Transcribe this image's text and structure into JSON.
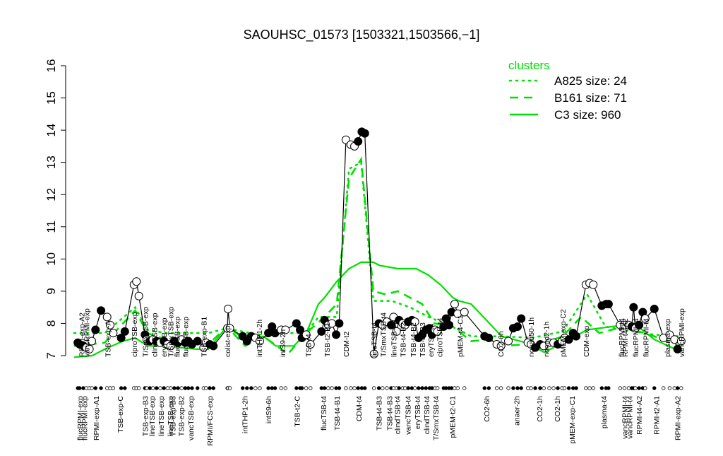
{
  "chart_data": {
    "type": "line",
    "title": "SAOUHSC_01573 [1503321,1503566,−1]",
    "xlabel": "",
    "ylabel": "",
    "xlim": [
      0,
      100
    ],
    "ylim": [
      7,
      16
    ],
    "yticks": [
      "7",
      "8",
      "9",
      "10",
      "11",
      "12",
      "13",
      "14",
      "15",
      "16"
    ],
    "grid": false,
    "legend": {
      "title": "clusters",
      "placement": "top-right",
      "entries": [
        {
          "label": "A825 size: 24",
          "style": "dotted"
        },
        {
          "label": "B161 size: 71",
          "style": "dashed"
        },
        {
          "label": "C3 size: 960",
          "style": "solid"
        }
      ]
    },
    "colors": {
      "cluster": "#00e000",
      "points": "#000000"
    },
    "points": [
      [
        0.6,
        7.4,
        1
      ],
      [
        0.9,
        7.35,
        1
      ],
      [
        1.5,
        7.3,
        1
      ],
      [
        2.0,
        7.25,
        0
      ],
      [
        2.5,
        7.2,
        0
      ],
      [
        2.9,
        7.45,
        0
      ],
      [
        3.5,
        7.8,
        1
      ],
      [
        4.4,
        8.4,
        1
      ],
      [
        5.4,
        8.2,
        0
      ],
      [
        5.9,
        7.95,
        0
      ],
      [
        6.4,
        7.7,
        0
      ],
      [
        7.7,
        7.55,
        1
      ],
      [
        8.3,
        7.75,
        1
      ],
      [
        9.8,
        9.2,
        0
      ],
      [
        10.2,
        9.3,
        0
      ],
      [
        10.6,
        8.85,
        0
      ],
      [
        11.6,
        7.65,
        1
      ],
      [
        11.9,
        7.5,
        0
      ],
      [
        12.4,
        7.45,
        1
      ],
      [
        12.9,
        7.5,
        0
      ],
      [
        13.5,
        7.45,
        1
      ],
      [
        14.1,
        7.4,
        0
      ],
      [
        14.7,
        7.45,
        1
      ],
      [
        15.3,
        7.35,
        0
      ],
      [
        15.8,
        7.3,
        0
      ],
      [
        16.4,
        7.45,
        1
      ],
      [
        17.0,
        7.4,
        1
      ],
      [
        17.6,
        7.5,
        0
      ],
      [
        18.2,
        7.4,
        1
      ],
      [
        18.7,
        7.45,
        1
      ],
      [
        19.3,
        7.35,
        1
      ],
      [
        20.2,
        7.45,
        1
      ],
      [
        21.2,
        7.25,
        0
      ],
      [
        21.6,
        7.4,
        0
      ],
      [
        22.2,
        7.35,
        1
      ],
      [
        22.8,
        7.3,
        1
      ],
      [
        25.1,
        7.85,
        0
      ],
      [
        25.2,
        8.45,
        0
      ],
      [
        25.5,
        7.85,
        0
      ],
      [
        27.6,
        7.6,
        1
      ],
      [
        28.3,
        7.45,
        1
      ],
      [
        29.0,
        7.6,
        1
      ],
      [
        29.7,
        7.55,
        0
      ],
      [
        30.4,
        7.45,
        0
      ],
      [
        31.8,
        7.7,
        1
      ],
      [
        32.4,
        7.9,
        1
      ],
      [
        32.9,
        7.7,
        1
      ],
      [
        33.9,
        7.8,
        0
      ],
      [
        34.6,
        7.8,
        0
      ],
      [
        36.4,
        8.0,
        1
      ],
      [
        37.0,
        7.8,
        1
      ],
      [
        37.3,
        7.55,
        1
      ],
      [
        38.0,
        7.65,
        0
      ],
      [
        38.7,
        7.35,
        0
      ],
      [
        40.5,
        7.75,
        1
      ],
      [
        41.0,
        8.1,
        1
      ],
      [
        41.6,
        7.95,
        0
      ],
      [
        42.2,
        8.0,
        0
      ],
      [
        42.9,
        7.65,
        1
      ],
      [
        43.4,
        8.0,
        1
      ],
      [
        44.5,
        13.7,
        0
      ],
      [
        45.3,
        13.55,
        0
      ],
      [
        45.9,
        13.5,
        0
      ],
      [
        46.5,
        13.65,
        1
      ],
      [
        47.1,
        13.95,
        1
      ],
      [
        47.6,
        13.9,
        1
      ],
      [
        49.1,
        7.05,
        0
      ],
      [
        49.9,
        8.0,
        1
      ],
      [
        50.5,
        7.95,
        0
      ],
      [
        51.2,
        8.05,
        0
      ],
      [
        51.9,
        7.95,
        1
      ],
      [
        52.3,
        8.2,
        0
      ],
      [
        52.8,
        7.75,
        0
      ],
      [
        53.2,
        8.1,
        1
      ],
      [
        53.8,
        8.0,
        0
      ],
      [
        54.2,
        7.95,
        0
      ],
      [
        54.7,
        8.05,
        1
      ],
      [
        55.3,
        8.1,
        1
      ],
      [
        55.8,
        8.05,
        0
      ],
      [
        56.4,
        7.55,
        1
      ],
      [
        57.0,
        7.65,
        1
      ],
      [
        57.6,
        7.8,
        1
      ],
      [
        58.2,
        7.85,
        1
      ],
      [
        58.6,
        7.65,
        1
      ],
      [
        59.1,
        7.8,
        0
      ],
      [
        59.5,
        7.75,
        0
      ],
      [
        60.5,
        7.9,
        1
      ],
      [
        60.9,
        8.15,
        1
      ],
      [
        61.4,
        7.95,
        1
      ],
      [
        61.8,
        8.35,
        1
      ],
      [
        62.3,
        8.6,
        0
      ],
      [
        62.8,
        8.3,
        0
      ],
      [
        63.9,
        8.35,
        0
      ],
      [
        67.2,
        7.6,
        1
      ],
      [
        67.9,
        7.55,
        1
      ],
      [
        69.2,
        7.35,
        0
      ],
      [
        69.9,
        7.3,
        0
      ],
      [
        71.1,
        7.45,
        0
      ],
      [
        71.9,
        7.85,
        1
      ],
      [
        72.6,
        7.9,
        1
      ],
      [
        73.2,
        8.15,
        1
      ],
      [
        74.3,
        7.4,
        0
      ],
      [
        74.8,
        7.35,
        0
      ],
      [
        75.5,
        7.25,
        1
      ],
      [
        76.3,
        7.35,
        1
      ],
      [
        76.9,
        7.3,
        0
      ],
      [
        77.8,
        7.4,
        0
      ],
      [
        78.5,
        7.4,
        0
      ],
      [
        79.2,
        7.35,
        1
      ],
      [
        79.9,
        7.45,
        0
      ],
      [
        80.3,
        7.55,
        0
      ],
      [
        81.0,
        7.5,
        1
      ],
      [
        81.7,
        7.7,
        1
      ],
      [
        82.2,
        7.6,
        1
      ],
      [
        83.8,
        9.2,
        0
      ],
      [
        84.4,
        9.25,
        0
      ],
      [
        85.0,
        9.2,
        0
      ],
      [
        86.4,
        8.55,
        1
      ],
      [
        87.1,
        8.6,
        1
      ],
      [
        87.5,
        8.6,
        1
      ],
      [
        89.4,
        7.95,
        0
      ],
      [
        90.1,
        7.95,
        0
      ],
      [
        90.8,
        7.95,
        0
      ],
      [
        91.3,
        7.9,
        1
      ],
      [
        91.6,
        8.5,
        1
      ],
      [
        91.9,
        7.85,
        0
      ],
      [
        92.5,
        7.95,
        1
      ],
      [
        93.1,
        8.35,
        1
      ],
      [
        93.5,
        8.15,
        0
      ],
      [
        95.0,
        8.45,
        1
      ],
      [
        96.5,
        7.55,
        0
      ],
      [
        97.5,
        7.65,
        0
      ],
      [
        98.3,
        7.5,
        0
      ],
      [
        98.8,
        7.2,
        1
      ],
      [
        99.4,
        7.45,
        0
      ]
    ],
    "series": [
      {
        "name": "C3",
        "style": "solid",
        "values": [
          [
            0,
            6.95
          ],
          [
            3,
            7.0
          ],
          [
            5,
            7.2
          ],
          [
            8,
            7.45
          ],
          [
            10,
            7.55
          ],
          [
            12,
            7.3
          ],
          [
            15,
            7.3
          ],
          [
            20,
            7.2
          ],
          [
            22,
            7.2
          ],
          [
            25,
            7.9
          ],
          [
            28,
            7.5
          ],
          [
            31,
            7.6
          ],
          [
            33,
            7.3
          ],
          [
            36,
            7.3
          ],
          [
            38,
            7.7
          ],
          [
            40,
            8.6
          ],
          [
            41,
            8.8
          ],
          [
            43,
            9.3
          ],
          [
            45,
            9.7
          ],
          [
            47,
            9.9
          ],
          [
            49,
            9.9
          ],
          [
            50,
            9.8
          ],
          [
            53,
            9.7
          ],
          [
            56,
            9.7
          ],
          [
            58,
            9.5
          ],
          [
            60,
            9.2
          ],
          [
            62,
            8.8
          ],
          [
            63,
            8.7
          ],
          [
            65,
            8.6
          ],
          [
            68,
            8.0
          ],
          [
            70,
            7.6
          ],
          [
            74,
            7.4
          ],
          [
            77,
            7.1
          ],
          [
            80,
            7.4
          ],
          [
            84,
            7.8
          ],
          [
            90,
            7.95
          ],
          [
            92,
            7.95
          ],
          [
            95,
            7.5
          ],
          [
            99,
            7.15
          ]
        ]
      },
      {
        "name": "B161",
        "style": "dashed",
        "values": [
          [
            0,
            7.3
          ],
          [
            5,
            7.4
          ],
          [
            10,
            8.4
          ],
          [
            12,
            7.7
          ],
          [
            15,
            7.5
          ],
          [
            22,
            7.35
          ],
          [
            25,
            7.9
          ],
          [
            28,
            7.3
          ],
          [
            31,
            7.6
          ],
          [
            35,
            7.05
          ],
          [
            38,
            7.7
          ],
          [
            41,
            8.2
          ],
          [
            43,
            8.6
          ],
          [
            45,
            12.5
          ],
          [
            47,
            13.1
          ],
          [
            49,
            9.0
          ],
          [
            51,
            8.9
          ],
          [
            53,
            9.0
          ],
          [
            55,
            8.8
          ],
          [
            57,
            8.6
          ],
          [
            59,
            8.0
          ],
          [
            62,
            7.9
          ],
          [
            65,
            7.45
          ],
          [
            68,
            7.5
          ],
          [
            70,
            7.3
          ],
          [
            74,
            7.35
          ],
          [
            77,
            7.4
          ],
          [
            80,
            7.6
          ],
          [
            83,
            8.2
          ],
          [
            86,
            7.7
          ],
          [
            90,
            7.9
          ],
          [
            95,
            7.6
          ],
          [
            99,
            7.3
          ]
        ]
      },
      {
        "name": "A825",
        "style": "dotted",
        "values": [
          [
            0,
            7.7
          ],
          [
            5,
            7.7
          ],
          [
            10,
            8.5
          ],
          [
            12,
            7.8
          ],
          [
            15,
            7.7
          ],
          [
            22,
            7.7
          ],
          [
            25,
            7.85
          ],
          [
            30,
            7.65
          ],
          [
            35,
            7.7
          ],
          [
            38,
            7.7
          ],
          [
            40,
            8.2
          ],
          [
            43,
            8.2
          ],
          [
            45,
            12.8
          ],
          [
            47,
            13.0
          ],
          [
            49,
            8.7
          ],
          [
            52,
            8.7
          ],
          [
            55,
            8.5
          ],
          [
            58,
            8.2
          ],
          [
            62,
            7.9
          ],
          [
            65,
            7.6
          ],
          [
            70,
            7.6
          ],
          [
            75,
            7.55
          ],
          [
            80,
            7.75
          ],
          [
            84,
            8.9
          ],
          [
            87,
            7.9
          ],
          [
            90,
            7.8
          ],
          [
            95,
            7.65
          ],
          [
            99,
            7.6
          ]
        ]
      }
    ],
    "point_labels": [
      [
        1.2,
        "RPMI-exp-A2"
      ],
      [
        2.0,
        "vancRPMI-exp"
      ],
      [
        5.5,
        "TSB-exp-A"
      ],
      [
        9.8,
        "ciproTSB-exp"
      ],
      [
        11.6,
        "T/SmxTSB-exp"
      ],
      [
        13.1,
        "clindTSB-exp"
      ],
      [
        14.7,
        "eryTSB-exp"
      ],
      [
        15.8,
        "T/SmxTSB-exp"
      ],
      [
        16.8,
        "flucTSB-exp"
      ],
      [
        18.2,
        "flucTSB-exp"
      ],
      [
        21.2,
        "TSB-exp-B1"
      ],
      [
        25.1,
        "colist-exp"
      ],
      [
        30.3,
        "intTHP1-2h"
      ],
      [
        34.1,
        "intS9-2h"
      ],
      [
        38.3,
        "TSB-t4"
      ],
      [
        41.4,
        "TSB-t2-B1"
      ],
      [
        44.5,
        "CDM-t2"
      ],
      [
        49.1,
        "lineTSB-t4"
      ],
      [
        50.6,
        "T/SmxTSB-t4"
      ],
      [
        52.3,
        "lineTSB-t4"
      ],
      [
        53.8,
        "TSB-t4-B2"
      ],
      [
        55.5,
        "TSB-t4-B2"
      ],
      [
        57.0,
        "TSB-t4-B3"
      ],
      [
        58.4,
        "eryTSB-t4"
      ],
      [
        59.8,
        "ciproTSB-t4"
      ],
      [
        63.2,
        "pMEM-t4-C1"
      ],
      [
        69.8,
        "CO2-6h"
      ],
      [
        74.8,
        "nonad50-1h"
      ],
      [
        77.3,
        "nonad2-1h"
      ],
      [
        80.0,
        "pMEM-exp-C2"
      ],
      [
        83.8,
        "CDM-exp"
      ],
      [
        89.6,
        "flucRPMI-t4"
      ],
      [
        90.2,
        "RPMI-t4-A2"
      ],
      [
        91.9,
        "flucRPMI-t4"
      ],
      [
        93.6,
        "flucRPMI-t4"
      ],
      [
        97.1,
        "plasma-exp"
      ],
      [
        99.4,
        "vancRPMI-exp"
      ]
    ],
    "axis_labels": [
      [
        0.9,
        "flucRPMI-exp"
      ],
      [
        1.7,
        "flucRPMI-exp"
      ],
      [
        3.6,
        "RPMI-exp-A1"
      ],
      [
        7.5,
        "TSB-exp-C"
      ],
      [
        11.6,
        "TSB-exp-B3"
      ],
      [
        12.7,
        "lineTSB-exp"
      ],
      [
        14.2,
        "lineTSB-exp"
      ],
      [
        15.7,
        "lineTSB-exp"
      ],
      [
        16.1,
        "TSB-exp-B3"
      ],
      [
        17.5,
        "TSB-exp-B2"
      ],
      [
        19.1,
        "vancTSB-exp"
      ],
      [
        22.2,
        "RPMI/FCS-exp"
      ],
      [
        27.9,
        "intTHP1-2h"
      ],
      [
        31.8,
        "intS9-6h"
      ],
      [
        36.5,
        "TSB-t2-C"
      ],
      [
        40.8,
        "flucTSB-t4"
      ],
      [
        43.0,
        "TSB-t4-B1"
      ],
      [
        46.6,
        "CDM-t4"
      ],
      [
        49.9,
        "TSB-t4-B3"
      ],
      [
        51.6,
        "TSB-t4-B3"
      ],
      [
        52.9,
        "clindTSB-t4"
      ],
      [
        54.6,
        "vancTSB-t4"
      ],
      [
        56.2,
        "eryTSB-t4"
      ],
      [
        57.7,
        "clindTSB-t4"
      ],
      [
        59.2,
        "T/SmxTSB-t4"
      ],
      [
        61.9,
        "pMEM-t2-C1"
      ],
      [
        67.5,
        "CO2-6h"
      ],
      [
        72.4,
        "anaer-2h"
      ],
      [
        76.2,
        "CO2-1h"
      ],
      [
        79.1,
        "CO2-1h"
      ],
      [
        81.5,
        "pMEM-exp-C1"
      ],
      [
        86.7,
        "plasma-t4"
      ],
      [
        90.1,
        "vancRPMI-t4"
      ],
      [
        90.9,
        "vancRPMI-t4"
      ],
      [
        92.5,
        "RPMI-t4-A2"
      ],
      [
        95.3,
        "RPMI-t2-A1"
      ],
      [
        98.8,
        "RPMI-exp-A2"
      ]
    ]
  }
}
